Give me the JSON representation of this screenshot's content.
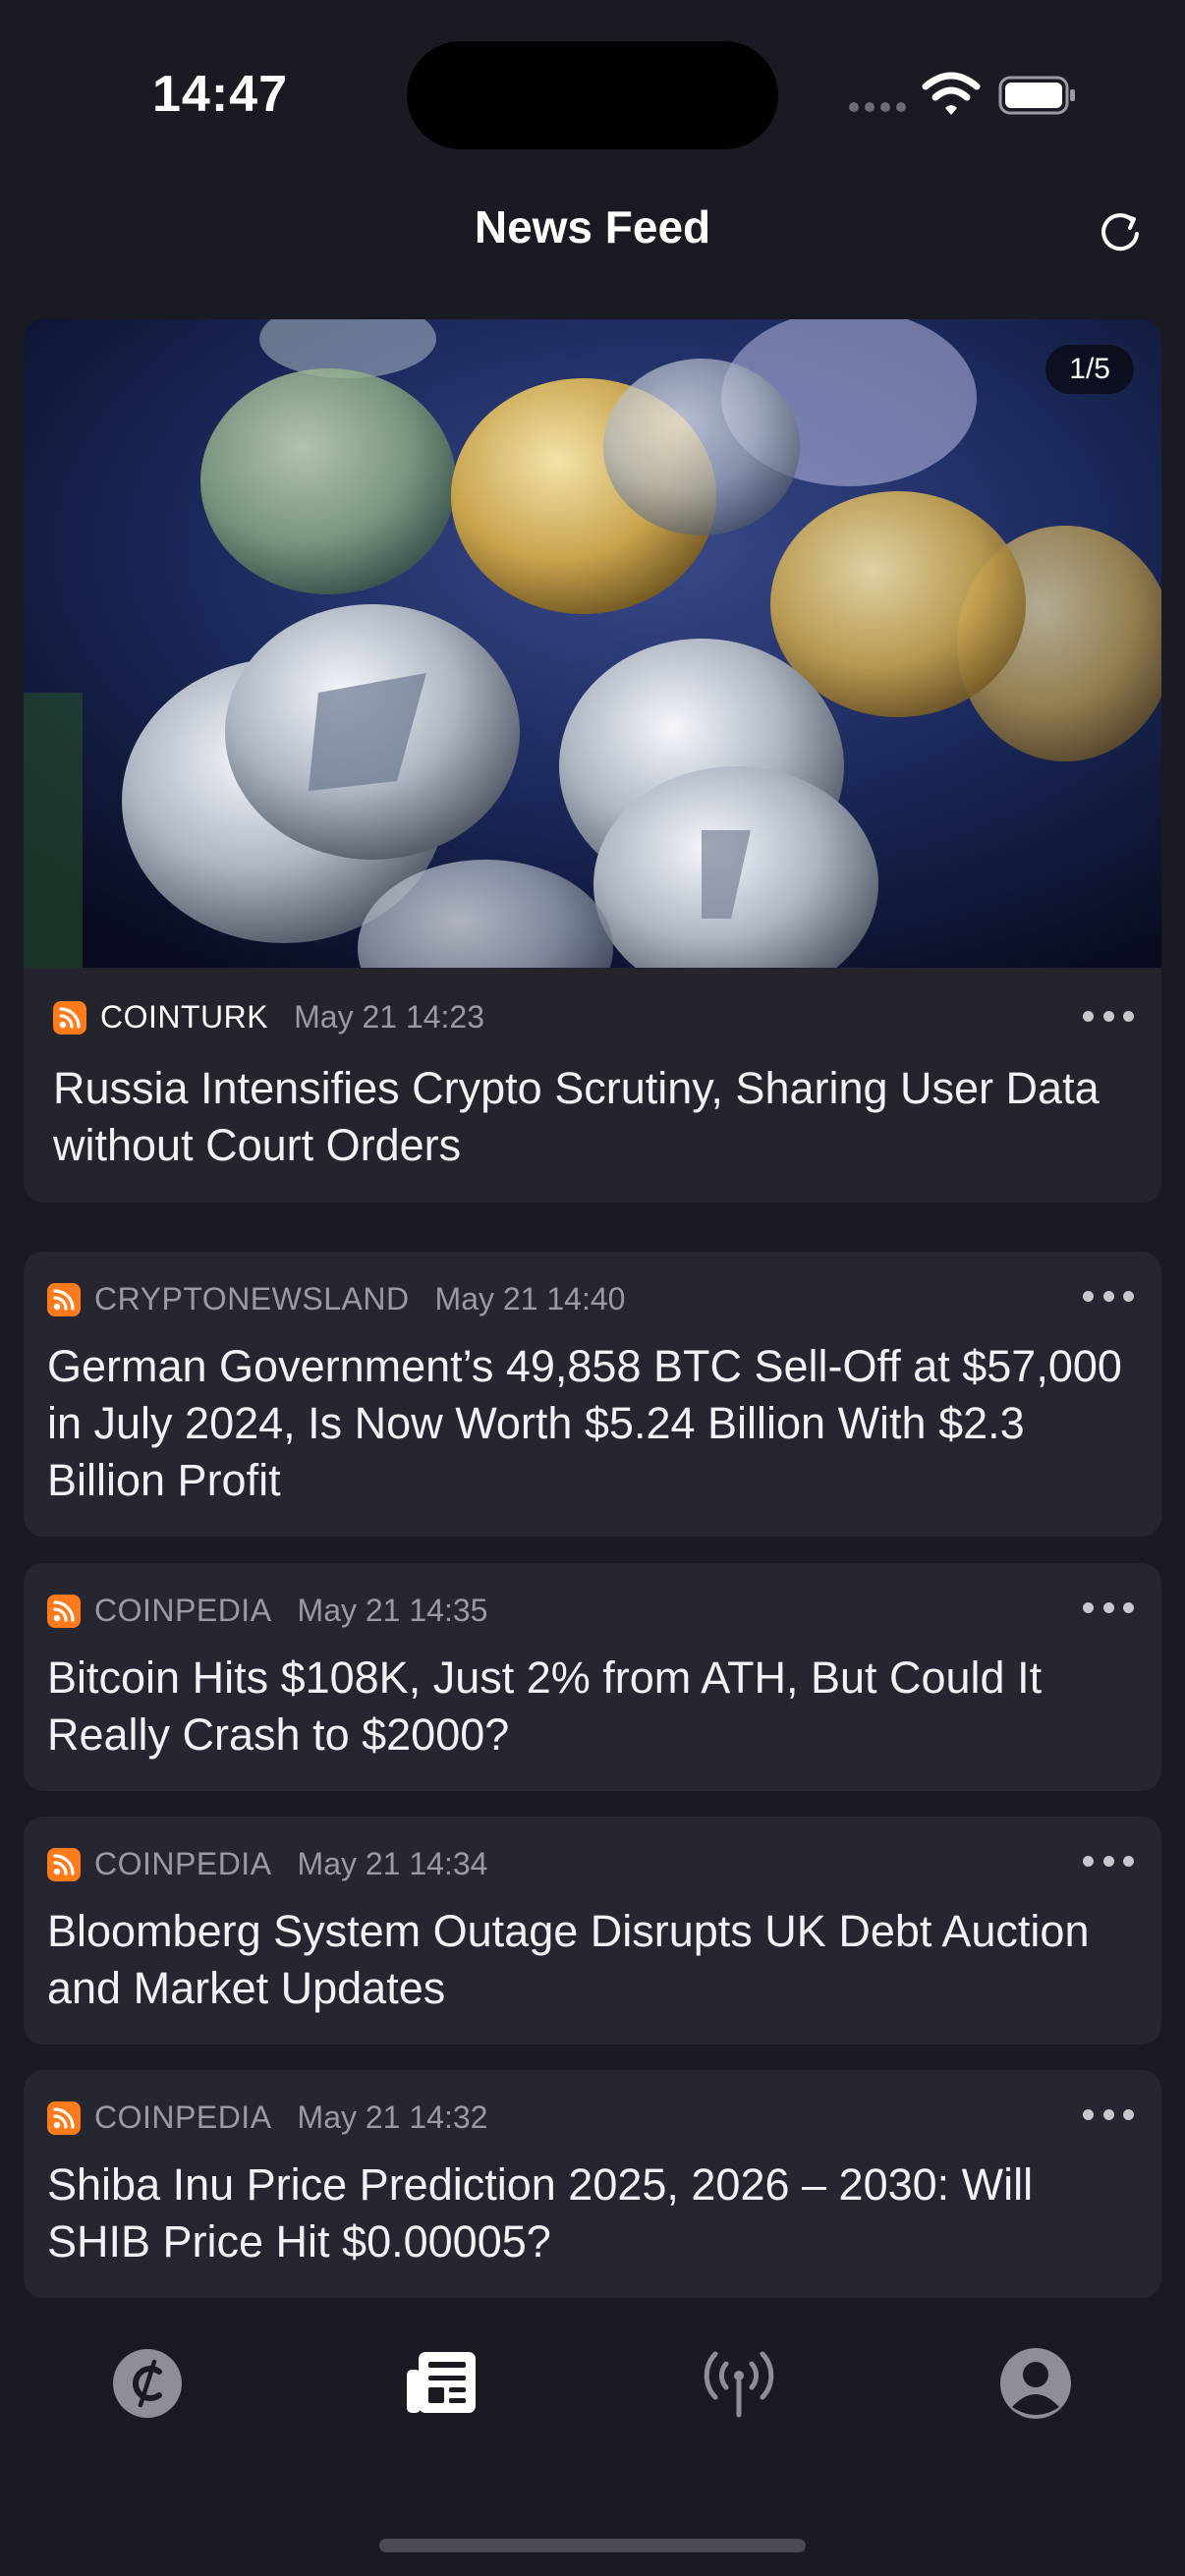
{
  "status_bar": {
    "time": "14:47"
  },
  "header": {
    "title": "News Feed",
    "refresh_icon": "refresh-icon"
  },
  "hero": {
    "counter": "1/5",
    "source": "COINTURK",
    "date": "May 21 14:23",
    "headline": "Russia Intensifies Crypto Scrutiny, Sharing User Data without Court Orders"
  },
  "articles": [
    {
      "source": "CRYPTONEWSLAND",
      "date": "May 21 14:40",
      "headline": "German Government’s 49,858 BTC Sell-Off at $57,000 in July 2024, Is Now Worth $5.24 Billion With $2.3 Billion Profit"
    },
    {
      "source": "COINPEDIA",
      "date": "May 21 14:35",
      "headline": "Bitcoin Hits $108K, Just 2% from ATH, But Could It Really Crash to $2000?"
    },
    {
      "source": "COINPEDIA",
      "date": "May 21 14:34",
      "headline": "Bloomberg System Outage Disrupts UK Debt Auction and Market Updates"
    },
    {
      "source": "COINPEDIA",
      "date": "May 21 14:32",
      "headline": "Shiba Inu Price Prediction 2025, 2026 – 2030: Will SHIB Price Hit $0.00005?"
    }
  ],
  "tab_bar": {
    "items": [
      {
        "icon": "coin-icon",
        "active": false
      },
      {
        "icon": "newspaper-icon",
        "active": true
      },
      {
        "icon": "broadcast-icon",
        "active": false
      },
      {
        "icon": "profile-icon",
        "active": false
      }
    ]
  },
  "colors": {
    "background": "#1a1a22",
    "card": "#262630",
    "rss": "#ff7a1a",
    "muted": "#9a9aa3"
  }
}
